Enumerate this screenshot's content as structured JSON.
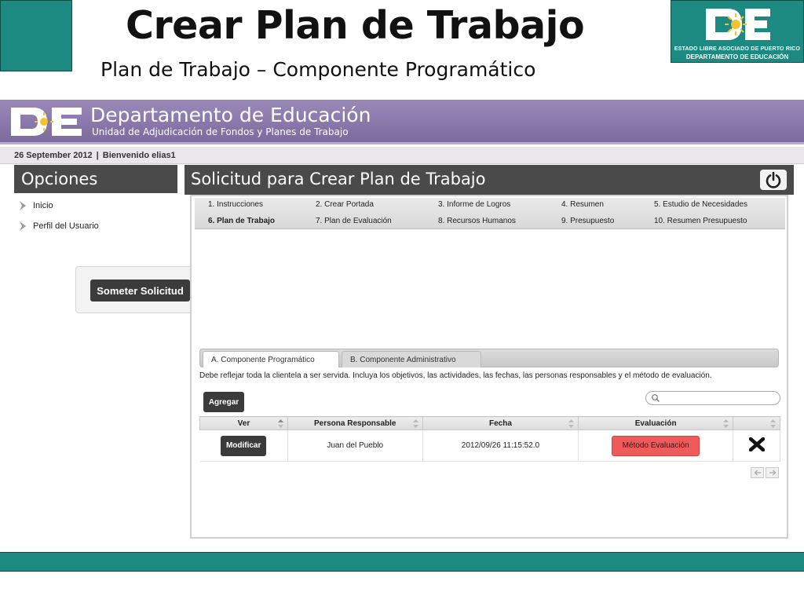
{
  "slide": {
    "title": "Crear Plan de Trabajo",
    "subtitle": "Plan de Trabajo – Componente Programático",
    "logo_line1": "ESTADO LIBRE ASOCIADO DE PUERTO RICO",
    "logo_line2": "DEPARTAMENTO DE EDUCACIÓN"
  },
  "colors": {
    "accent": "#1c8a80",
    "banner": "#8a78aa",
    "dark_button": "#3b3b3b",
    "evaluation_button": "#f05a5a"
  },
  "app": {
    "title": "Departamento de Educación",
    "subtitle": "Unidad de Adjudicación de Fondos y Planes de Trabajo",
    "date": "26 September 2012",
    "welcome": "Bienvenido elias1"
  },
  "sidebar": {
    "header": "Opciones",
    "items": [
      {
        "label": "Inicio",
        "icon": "chevron-right-icon"
      },
      {
        "label": "Perfil del Usuario",
        "icon": "chevron-right-icon"
      }
    ],
    "submit_label": "Someter Solicitud"
  },
  "main": {
    "header": "Solicitud para Crear Plan de Trabajo",
    "power_icon": "power-icon",
    "steps": [
      "1. Instrucciones",
      "2. Crear Portada",
      "3. Informe de Logros",
      "4. Resumen",
      "5. Estudio de Necesidades",
      "6. Plan de Trabajo",
      "7. Plan de Evaluación",
      "8. Recursos Humanos",
      "9. Presupuesto",
      "10. Resumen Presupuesto"
    ],
    "active_step": "6. Plan de Trabajo",
    "tabs": [
      {
        "label": "A. Componente Programático",
        "active": true
      },
      {
        "label": "B. Componente Administrativo",
        "active": false
      }
    ],
    "instructions": "Debe reflejar toda la clientela a ser servida. Incluya los objetivos, las actividades, las fechas, las personas responsables y el método de evaluación.",
    "add_label": "Agregar",
    "search_placeholder": "",
    "table": {
      "headers": [
        "Ver",
        "Persona Responsable",
        "Fecha",
        "Evaluación",
        ""
      ],
      "rows": [
        {
          "ver": "Modificar",
          "persona": "Juan del Pueblo",
          "fecha": "2012/09/26 11:15:52.0",
          "evaluacion": "Método Evaluación",
          "delete_icon": "delete-x-icon"
        }
      ]
    },
    "pager_icons": [
      "arrow-left-icon",
      "arrow-right-icon"
    ]
  }
}
